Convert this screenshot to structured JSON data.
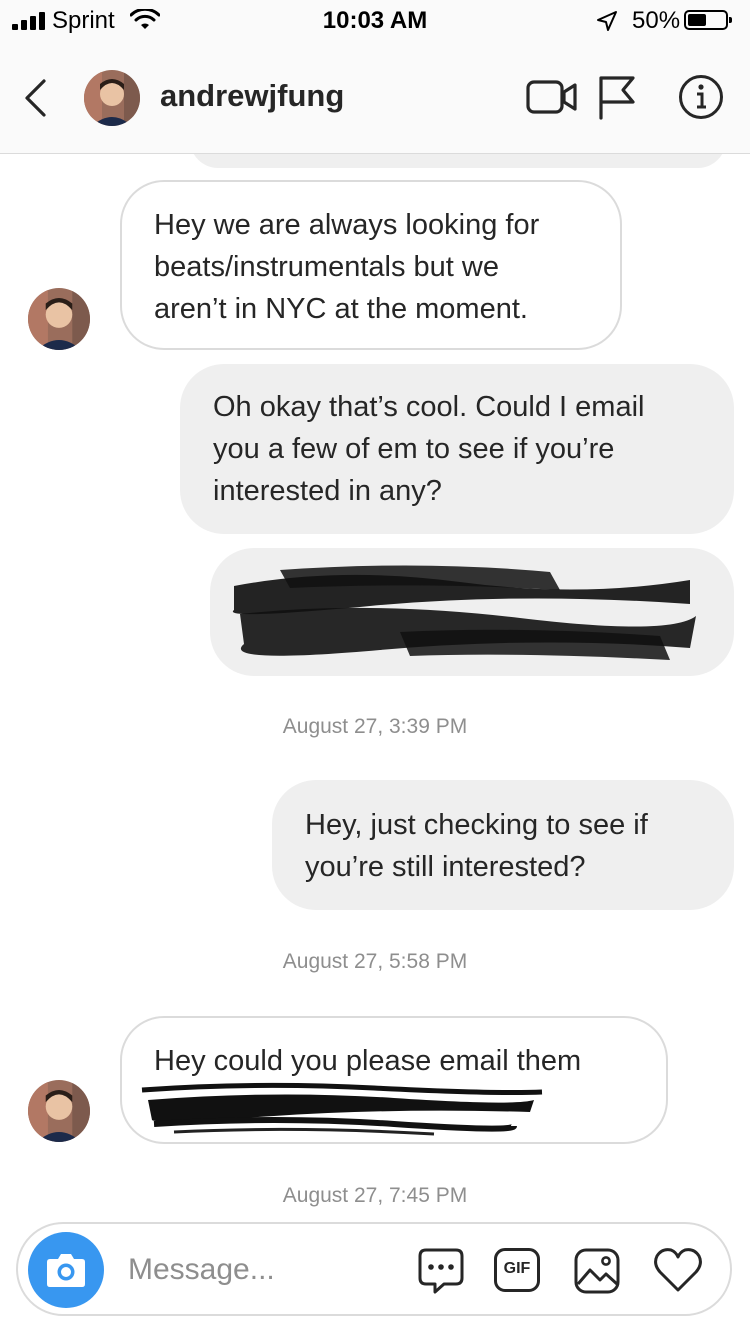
{
  "status_bar": {
    "carrier": "Sprint",
    "time": "10:03 AM",
    "battery_percent": "50%",
    "battery_level": 0.5,
    "icons": [
      "signal-icon",
      "wifi-icon",
      "location-arrow-icon",
      "battery-icon"
    ]
  },
  "header": {
    "username": "andrewjfung",
    "icons": [
      "back-chevron-icon",
      "avatar",
      "video-call-icon",
      "flag-icon",
      "info-icon"
    ]
  },
  "messages": [
    {
      "direction": "in",
      "lines": [
        "Hey we are always looking for",
        "beats/instrumentals  but we",
        "aren’t in NYC at the moment."
      ]
    },
    {
      "direction": "out",
      "lines": [
        "Oh okay that’s cool. Could I email",
        "you a few of em to see if you’re",
        "interested in any?"
      ]
    },
    {
      "direction": "out",
      "redacted": true
    },
    {
      "timestamp": "August 27, 3:39 PM"
    },
    {
      "direction": "out",
      "lines": [
        "Hey, just checking to see if",
        "you’re still interested?"
      ]
    },
    {
      "timestamp": "August 27, 5:58 PM"
    },
    {
      "direction": "in",
      "lines": [
        "Hey could you please email them"
      ],
      "redacted_tail": true
    },
    {
      "timestamp": "August 27, 7:45 PM"
    }
  ],
  "composer": {
    "placeholder": "Message...",
    "gif_label": "GIF",
    "icons": [
      "camera-icon",
      "chat-bubble-icon",
      "gif-icon",
      "gallery-icon",
      "heart-icon"
    ]
  },
  "colors": {
    "accent_blue": "#3897f0",
    "outgoing_bubble": "#efefef",
    "border": "#dbdbdb",
    "secondary_text": "#8e8e8e"
  }
}
